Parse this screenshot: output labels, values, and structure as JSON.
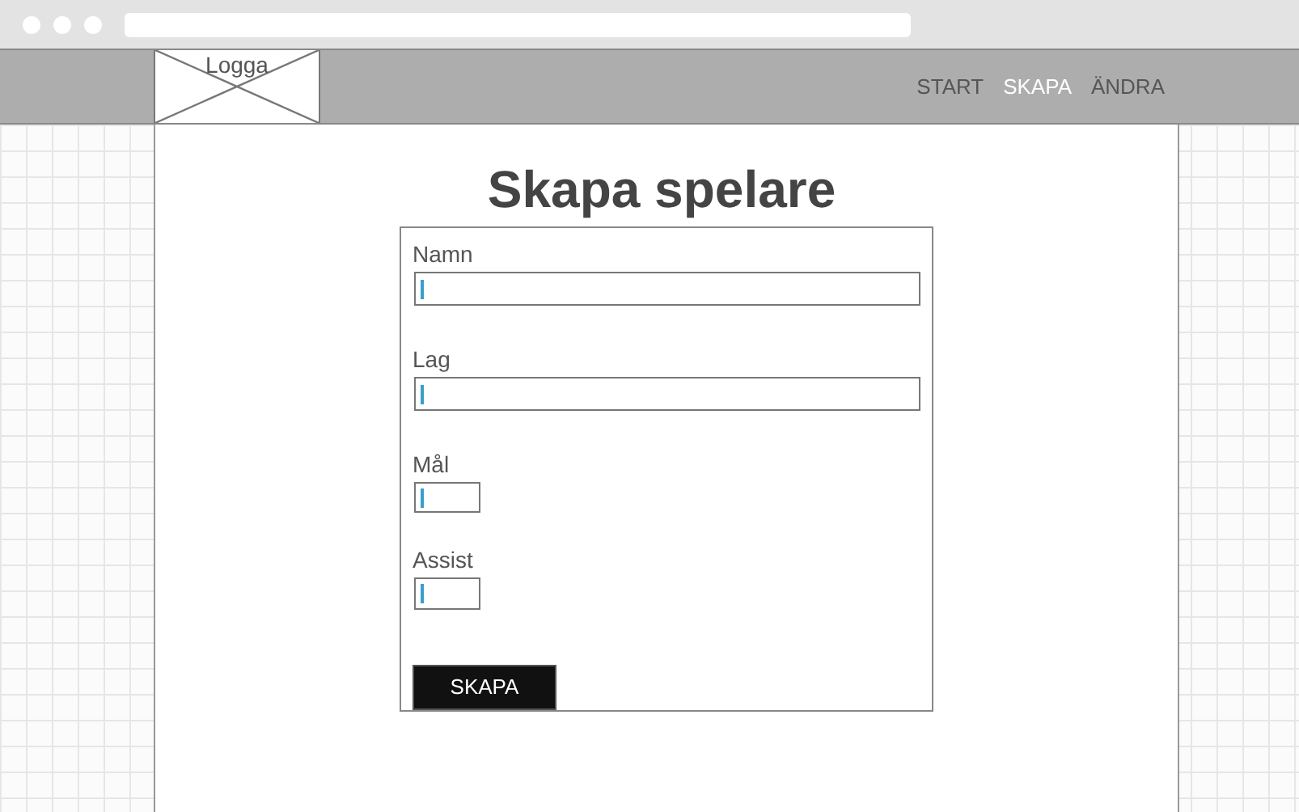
{
  "header": {
    "logo": "Logga",
    "nav": [
      {
        "label": "START",
        "selected": false
      },
      {
        "label": "SKAPA",
        "selected": true
      },
      {
        "label": "ÄNDRA",
        "selected": false
      }
    ]
  },
  "title": "Skapa spelare",
  "form": {
    "fields": [
      {
        "label": "Namn",
        "kind": "wide"
      },
      {
        "label": "Lag",
        "kind": "wide"
      },
      {
        "label": "Mål",
        "kind": "narrow"
      },
      {
        "label": "Assist",
        "kind": "narrow"
      }
    ],
    "submit": "SKAPA"
  }
}
